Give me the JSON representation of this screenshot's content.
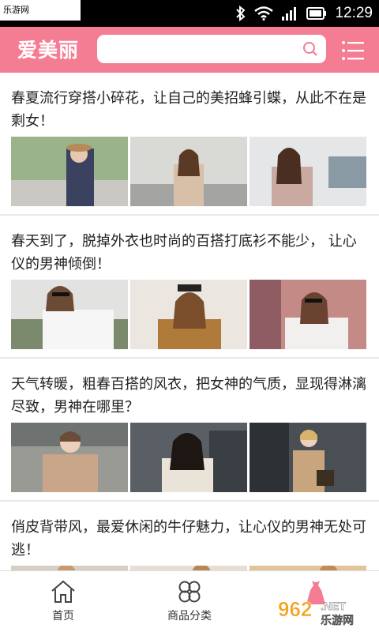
{
  "status": {
    "watermark": "乐游网 www.962.net",
    "time": "12:29"
  },
  "header": {
    "title": "爱美丽",
    "search_placeholder": "",
    "brand_color": "#f47c93"
  },
  "articles": [
    {
      "title": "春夏流行穿搭小碎花，让自己的美招蜂引蝶，从此不在是剩女！"
    },
    {
      "title": "春天到了，脱掉外衣也时尚的百搭打底衫不能少， 让心仪的男神倾倒！"
    },
    {
      "title": "天气转暖，粗春百搭的风衣，把女神的气质，显现得淋漓尽致，男神在哪里？"
    },
    {
      "title": "俏皮背带风，最爱休闲的牛仔魅力，让心仪的男神无处可逃！"
    }
  ],
  "nav": {
    "items": [
      {
        "label": "首页",
        "icon": "home-icon"
      },
      {
        "label": "商品分类",
        "icon": "category-icon"
      },
      {
        "label": "",
        "icon": "dress-icon"
      }
    ]
  },
  "watermark_br": "962.NET 乐游网"
}
